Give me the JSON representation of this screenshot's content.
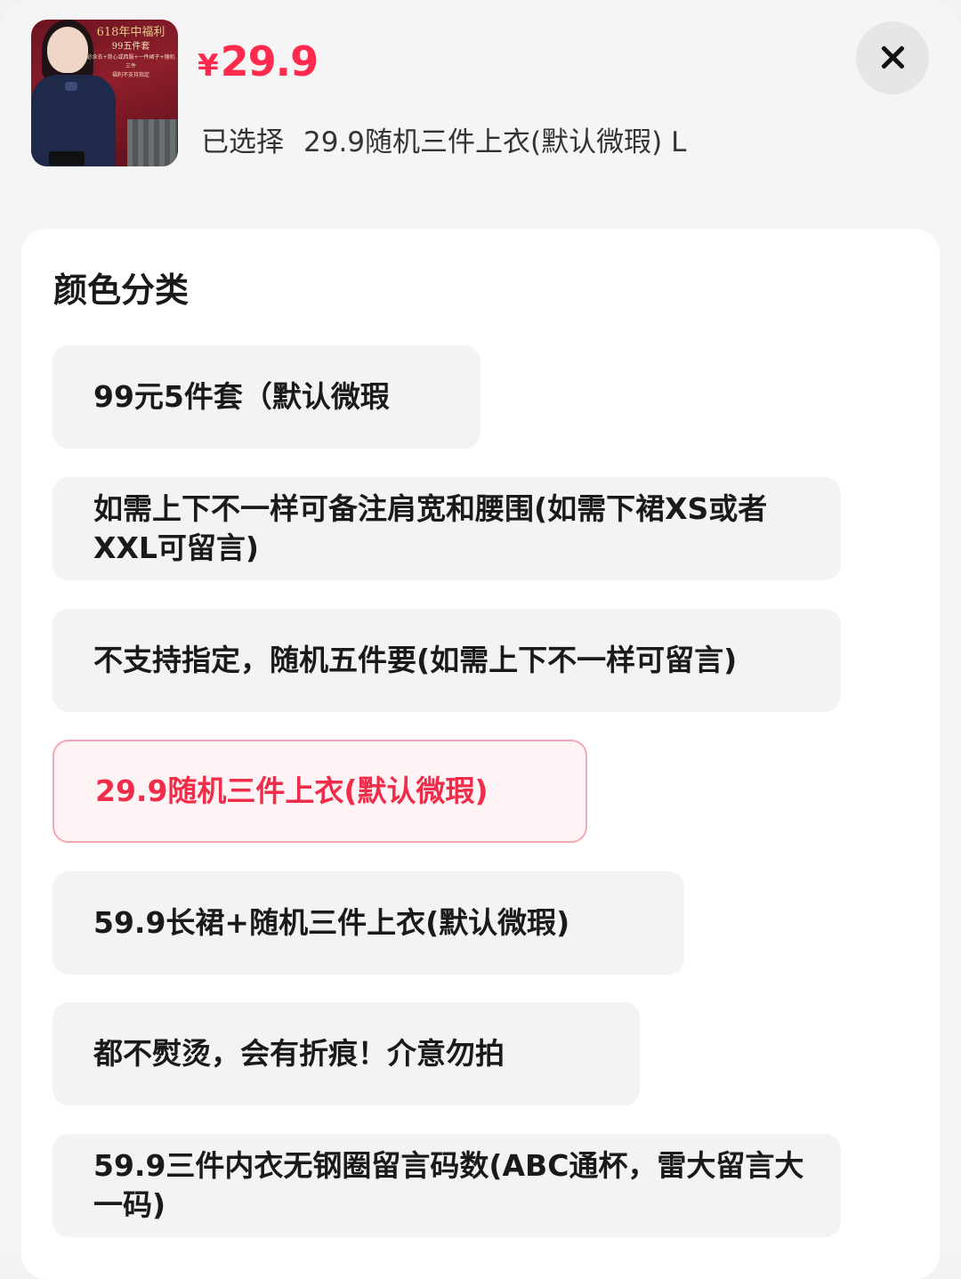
{
  "product": {
    "thumbnail": {
      "title": "618年中福利",
      "sub": "99五件套",
      "line1": "必含衣+背心或西服+一件裙子+随机三件",
      "line2": "福利不支持指定"
    },
    "currency": "¥",
    "price": "29.9",
    "selected_label": "已选择",
    "selected_value": "29.9随机三件上衣(默认微瑕) L"
  },
  "close_icon": "close-icon",
  "section": {
    "title": "颜色分类"
  },
  "options": [
    {
      "label": "99元5件套（默认微瑕",
      "selected": false
    },
    {
      "label": "如需上下不一样可备注肩宽和腰围(如需下裙XS或者XXL可留言)",
      "selected": false
    },
    {
      "label": "不支持指定，随机五件要(如需上下不一样可留言)",
      "selected": false
    },
    {
      "label": "29.9随机三件上衣(默认微瑕)",
      "selected": true
    },
    {
      "label": "59.9长裙+随机三件上衣(默认微瑕)",
      "selected": false
    },
    {
      "label": "都不熨烫，会有折痕！介意勿拍",
      "selected": false
    },
    {
      "label": "59.9三件内衣无钢圈留言码数(ABC通杯，雷大留言大一码)",
      "selected": false
    }
  ],
  "colors": {
    "accent": "#ff2a4d",
    "selected_border": "#f2a8b2",
    "option_bg": "#f3f3f3"
  }
}
